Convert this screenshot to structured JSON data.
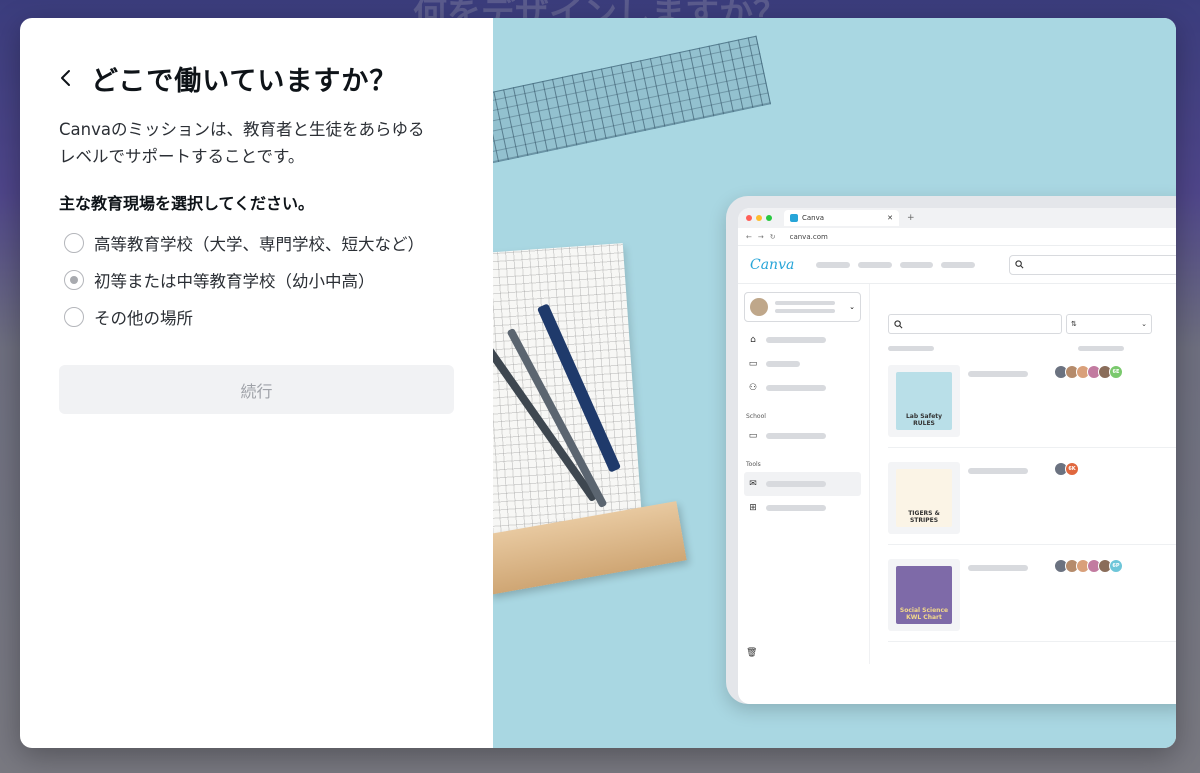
{
  "backdrop": {
    "heading": "何をデザインしますか？"
  },
  "modal": {
    "title": "どこで働いていますか？",
    "description_line1": "Canvaのミッションは、教育者と生徒をあらゆる",
    "description_line2": "レベルでサポートすることです。",
    "question": "主な教育現場を選択してください。",
    "options": [
      {
        "label": "高等教育学校（大学、専門学校、短大など）",
        "selected": false
      },
      {
        "label": "初等または中等教育学校（幼小中高）",
        "selected": true
      },
      {
        "label": "その他の場所",
        "selected": false
      }
    ],
    "continue_label": "続行"
  },
  "illustration": {
    "browser_tab_label": "Canva",
    "url": "canva.com",
    "logo": "Canva",
    "sidebar_sections": [
      "School",
      "Tools"
    ],
    "thumbnails": [
      {
        "caption": "Lab Safety RULES",
        "color": "#b9dfe8"
      },
      {
        "caption": "TIGERS & STRIPES",
        "color": "#fbf4e6"
      },
      {
        "caption": "Social Science KWL Chart",
        "color": "#7e6aa8"
      }
    ],
    "avatar_badges": [
      "6E",
      "6K",
      "6P"
    ]
  },
  "colors": {
    "accent": "#27a5d8",
    "title_text": "#0e1318",
    "disabled_button_bg": "#f1f2f4",
    "illustration_bg": "#a9d7e2"
  }
}
